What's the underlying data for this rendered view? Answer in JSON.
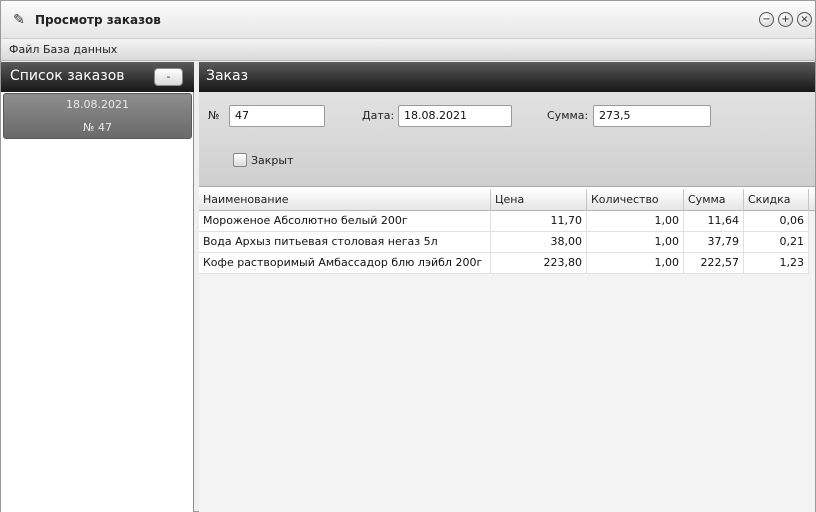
{
  "window": {
    "title": "Просмотр заказов",
    "controls": [
      "minimize-icon",
      "maximize-icon",
      "close-icon"
    ]
  },
  "menu": [
    "Файл",
    "База данных"
  ],
  "orders_list": {
    "title": "Список заказов",
    "collapse_label": "-",
    "items": [
      {
        "date": "18.08.2021",
        "number": "№ 47"
      }
    ]
  },
  "order": {
    "title": "Заказ",
    "number_label": "№",
    "number_value": "47",
    "date_label": "Дата:",
    "date_value": "18.08.2021",
    "sum_label": "Сумма:",
    "sum_value": "273,5",
    "closed_label": "Закрыт",
    "closed_checked": false
  },
  "table": {
    "columns": [
      "Наименование",
      "Цена",
      "Количество",
      "Сумма",
      "Скидка"
    ],
    "rows": [
      [
        "Мороженое Абсолютно белый 200г",
        "11,70",
        "1,00",
        "11,64",
        "0,06"
      ],
      [
        "Вода Архыз питьевая столовая негаз 5л",
        "38,00",
        "1,00",
        "37,79",
        "0,21"
      ],
      [
        "Кофе растворимый Амбассадор блю лэйбл 200г",
        "223,80",
        "1,00",
        "222,57",
        "1,23"
      ]
    ]
  },
  "colors": {
    "header_dark": "#161616",
    "selected_item": "#7a7a7a"
  }
}
